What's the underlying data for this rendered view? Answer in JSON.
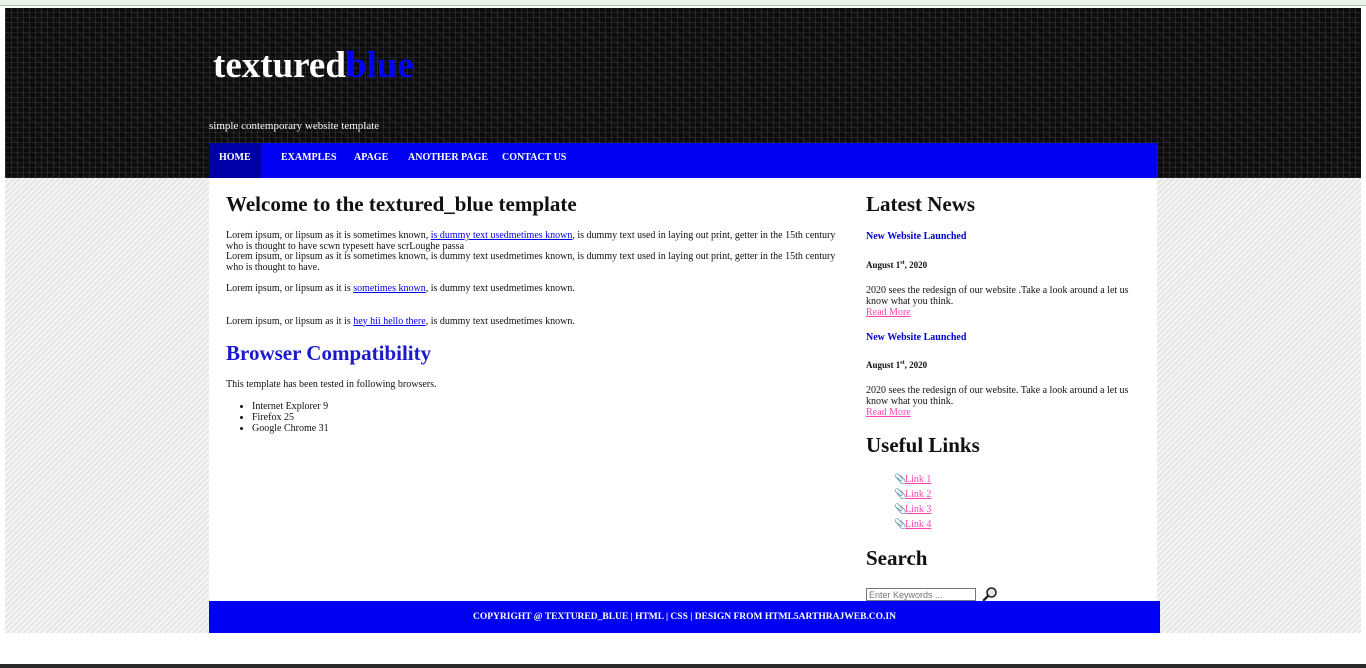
{
  "site": {
    "logo_main": "textured",
    "logo_accent": "blue",
    "slogan": "simple contemporary website template"
  },
  "menu": {
    "items": [
      {
        "label": "Home"
      },
      {
        "label": "Examples"
      },
      {
        "label": "APage"
      },
      {
        "label": "Another Page"
      },
      {
        "label": "Contact Us"
      }
    ]
  },
  "main": {
    "heading": "Welcome to the textured_blue template",
    "p1_a": "Lorem ipsum, or lipsum as it is sometimes known, ",
    "p1_link": "is dummy text usedmetimes known",
    "p1_b": ", is dummy text used in laying out print, getter in the 15th century who is thought to have scwn typesett have scrLoughe passa",
    "p1_c": "Lorem ipsum, or lipsum as it is sometimes known, is dummy text usedmetimes known, is dummy text used in laying out print, getter in the 15th century who is thought to have.",
    "p2_a": "Lorem ipsum, or lipsum as it is ",
    "p2_link": "sometimes known",
    "p2_b": ", is dummy text usedmetimes known.",
    "p3_a": "Lorem ipsum, or lipsum as it is ",
    "p3_link": "hey hii hello there",
    "p3_b": ", is dummy text usedmetimes known.",
    "subheading": "Browser Compatibility",
    "tested_text": "This template has been tested in following browsers.",
    "browsers": [
      "Internet Explorer 9",
      "Firefox 25",
      "Google Chrome 31"
    ]
  },
  "sidebar": {
    "news_heading": "Latest News",
    "news": [
      {
        "title": "New Website Launched",
        "date_pre": "August 1",
        "date_sup": "st",
        "date_post": ", 2020",
        "text": "2020 sees the redesign of our website .Take a look around a let us know what you think.",
        "readmore": "Read More"
      },
      {
        "title": "New Website Launched",
        "date_pre": "August 1",
        "date_sup": "st",
        "date_post": ", 2020",
        "text": "2020 sees the redesign of our website. Take a look around a let us know what you think.",
        "readmore": "Read More"
      }
    ],
    "links_heading": "Useful Links",
    "links": [
      "Link 1",
      "Link 2",
      "Link 3",
      "Link 4"
    ],
    "search_heading": "Search",
    "search_placeholder": "Enter Keywords ..."
  },
  "footer": {
    "text": "Copyright @ textured_blue | HTML | CSS | Design From html5arthrajweb.co.in"
  },
  "colors": {
    "menu_bg": "#0000f5",
    "selected_bg": "#0000a8",
    "link_pink": "#ff44b0",
    "header_bg": "#0c0c0c"
  }
}
